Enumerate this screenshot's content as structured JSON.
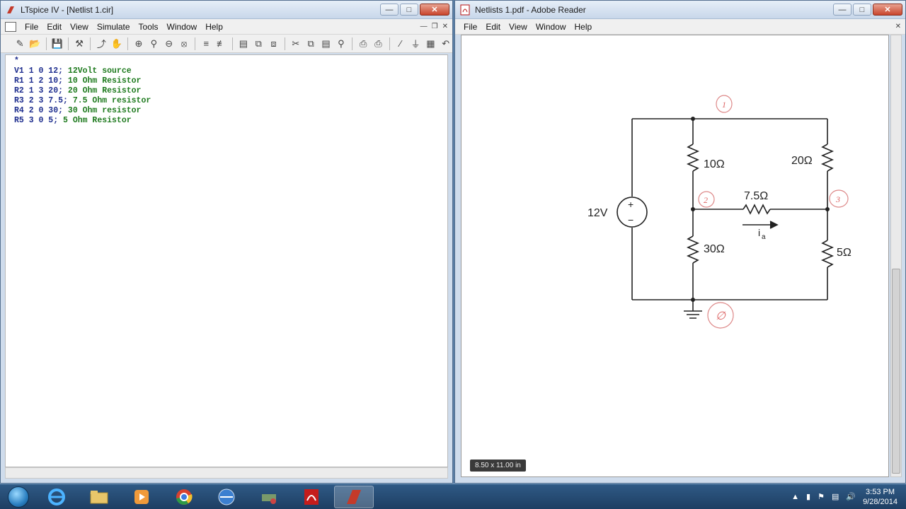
{
  "ltspice": {
    "title": "LTspice IV - [Netlist 1.cir]",
    "menu": [
      "File",
      "Edit",
      "View",
      "Simulate",
      "Tools",
      "Window",
      "Help"
    ],
    "lines": [
      {
        "code": "*",
        "comment": ""
      },
      {
        "code": "V1 1 0 12; ",
        "comment": "12Volt source"
      },
      {
        "code": "R1 1 2 10; ",
        "comment": "10 Ohm Resistor"
      },
      {
        "code": "R2 1 3 20; ",
        "comment": "20 Ohm Resistor"
      },
      {
        "code": "R3 2 3 7.5; ",
        "comment": "7.5 Ohm resistor"
      },
      {
        "code": "R4 2 0 30; ",
        "comment": "30 Ohm resistor"
      },
      {
        "code": "R5 3 0 5; ",
        "comment": "5 Ohm Resistor"
      }
    ]
  },
  "reader": {
    "title": "Netlists 1.pdf - Adobe Reader",
    "menu": [
      "File",
      "Edit",
      "View",
      "Window",
      "Help"
    ],
    "page_size": "8.50 x 11.00 in",
    "circuit": {
      "source": "12V",
      "plus": "+",
      "minus": "−",
      "r1": "10Ω",
      "r2": "20Ω",
      "r3": "7.5Ω",
      "r4": "30Ω",
      "r5": "5Ω",
      "current": "i",
      "current_sub": "a",
      "node1": "1",
      "node2": "2",
      "node3": "3",
      "node0": "∅"
    }
  },
  "taskbar": {
    "time": "3:53 PM",
    "date": "9/28/2014"
  }
}
